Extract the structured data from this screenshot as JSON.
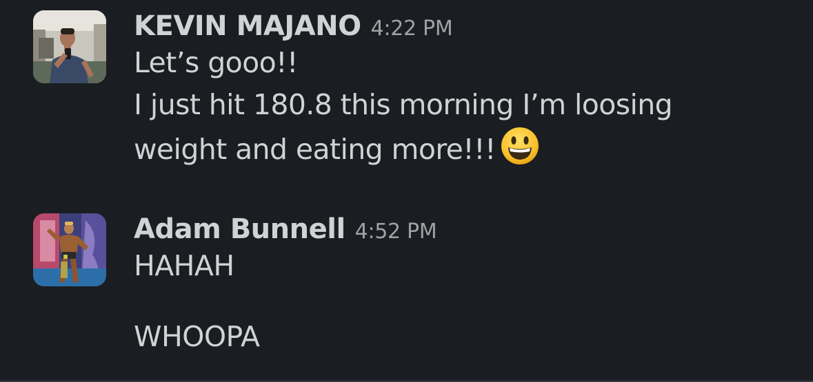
{
  "messages": [
    {
      "sender": "KEVIN MAJANO",
      "time": "4:22 PM",
      "lines": [
        "Let’s gooo!!",
        "I just hit 180.8 this morning I’m loosing",
        "weight and eating more!!!"
      ],
      "trailing_emoji": "grinning-face-emoji",
      "avatar_icon": "gym-mirror-selfie-avatar"
    },
    {
      "sender": "Adam Bunnell",
      "time": "4:52 PM",
      "lines": [
        "HAHAH",
        "",
        "WHOOPA"
      ],
      "avatar_icon": "bodybuilder-stage-avatar"
    }
  ],
  "colors": {
    "background": "#1a1d21",
    "text": "#d1d2d3",
    "timestamp": "#a1a2a4"
  }
}
